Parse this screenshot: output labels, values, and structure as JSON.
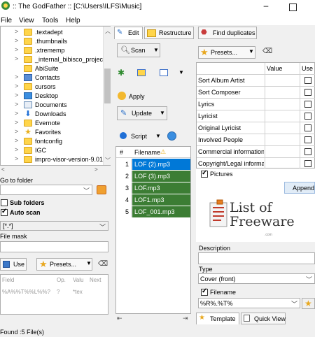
{
  "window": {
    "title": ":: The GodFather ::  [C:\\Users\\ILFS\\Music]",
    "minimize": "–"
  },
  "menu": [
    "File",
    "View",
    "Tools",
    "Help"
  ],
  "tree": {
    "items": [
      {
        "label": ".textadept",
        "icon": "folder-icon"
      },
      {
        "label": ".thumbnails",
        "icon": "folder-icon"
      },
      {
        "label": ".xtrememp",
        "icon": "folder-icon"
      },
      {
        "label": "_internal_bibisco_projec",
        "icon": "folder-icon"
      },
      {
        "label": "AbiSuite",
        "icon": "folder-icon"
      },
      {
        "label": "Contacts",
        "icon": "contacts-icon"
      },
      {
        "label": "cursors",
        "icon": "folder-icon"
      },
      {
        "label": "Desktop",
        "icon": "desktop-icon"
      },
      {
        "label": "Documents",
        "icon": "documents-icon"
      },
      {
        "label": "Downloads",
        "icon": "downloads-icon"
      },
      {
        "label": "Evernote",
        "icon": "folder-icon"
      },
      {
        "label": "Favorites",
        "icon": "favorites-icon"
      },
      {
        "label": "fontconfig",
        "icon": "folder-icon"
      },
      {
        "label": "IGC",
        "icon": "folder-icon"
      },
      {
        "label": "impro-visor-version-9.01",
        "icon": "folder-icon"
      }
    ]
  },
  "left": {
    "go_to_folder_label": "Go to folder",
    "go_to_folder_value": "",
    "sub_folders_label": "Sub folders",
    "sub_folders_checked": false,
    "auto_scan_label": "Auto scan",
    "auto_scan_checked": true,
    "file_mask_combo": "[*.*]",
    "file_mask_label": "File mask",
    "file_mask_value": "",
    "use_label": "Use",
    "presets_label": "Presets...",
    "grid_headers": [
      "Field",
      "Op.",
      "Valu",
      "Next"
    ],
    "grid_row": [
      "%A%%T%%L%%?",
      "?",
      "*tex",
      ""
    ]
  },
  "status": "Found :5 File(s)",
  "tabs": {
    "edit": "Edit",
    "restructure": "Restructure",
    "find_duplicates": "Find duplicates"
  },
  "tools": {
    "scan": "Scan",
    "apply": "Apply",
    "update": "Update",
    "script": "Script"
  },
  "files": {
    "headers": [
      "#",
      "Filename"
    ],
    "rows": [
      {
        "num": "1",
        "name": "LOF (2).mp3",
        "selected": true
      },
      {
        "num": "2",
        "name": "LOF (3).mp3",
        "selected": false
      },
      {
        "num": "3",
        "name": "LOF.mp3",
        "selected": false
      },
      {
        "num": "4",
        "name": "LOF1.mp3",
        "selected": false
      },
      {
        "num": "5",
        "name": "LOF_001.mp3",
        "selected": false
      }
    ]
  },
  "tags": {
    "presets_label": "Presets...",
    "headers": [
      "Value",
      "Use"
    ],
    "rows": [
      "Sort Album Artist",
      "Sort Composer",
      "Lyrics",
      "Lyricist",
      "Original Lyricist",
      "Involved People",
      "Commercial information",
      "Copyright/Legal informa"
    ]
  },
  "pictures": {
    "label": "Pictures",
    "checked": true,
    "append_label": "Append",
    "logo_main": "List of",
    "logo_second": "Freeware",
    "logo_sub": ".com",
    "description_label": "Description",
    "description_value": "",
    "type_label": "Type",
    "type_value": "Cover (front)",
    "filename_label": "Filename",
    "filename_checked": true,
    "filename_value": "%R%.%T%"
  },
  "bottom_tabs": {
    "template": "Template",
    "quick_view": "Quick View"
  },
  "colors": {
    "selected_row": "#0078d7",
    "file_row": "#3c7d34",
    "tab_blue": "#0078d7",
    "append_bg": "#e1ecf7"
  }
}
